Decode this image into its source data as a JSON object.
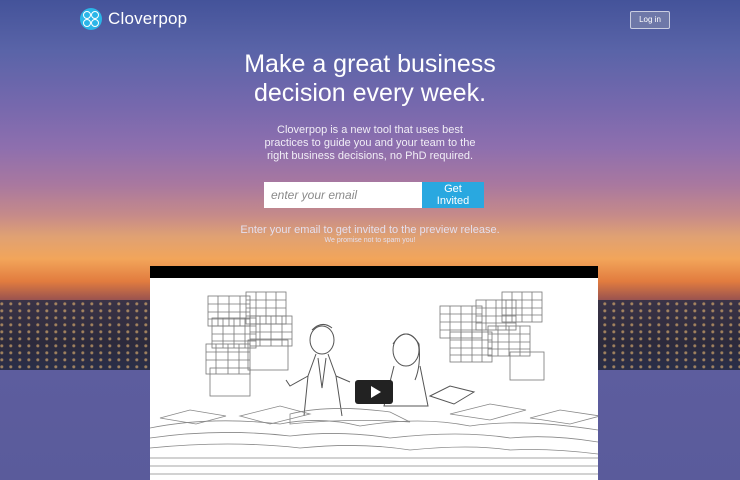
{
  "header": {
    "brand": "Cloverpop",
    "logo_icon": "clover-logo-icon",
    "login_label": "Log in"
  },
  "hero": {
    "headline_lines": [
      "Make a great business",
      "decision every week."
    ],
    "subtext_lines": [
      "Cloverpop is a new tool that uses best",
      "practices to guide you and your team to the",
      "right business decisions, no PhD required."
    ]
  },
  "signup": {
    "email_placeholder": "enter your email",
    "button_label": "Get Invited",
    "note": "Enter your email to get invited to the preview release.",
    "note_small": "We promise not to spam you!"
  },
  "video": {
    "play_icon": "play-icon"
  },
  "colors": {
    "accent": "#29a8e0",
    "logo": "#2bb6e8",
    "video_bar": "#000000"
  }
}
